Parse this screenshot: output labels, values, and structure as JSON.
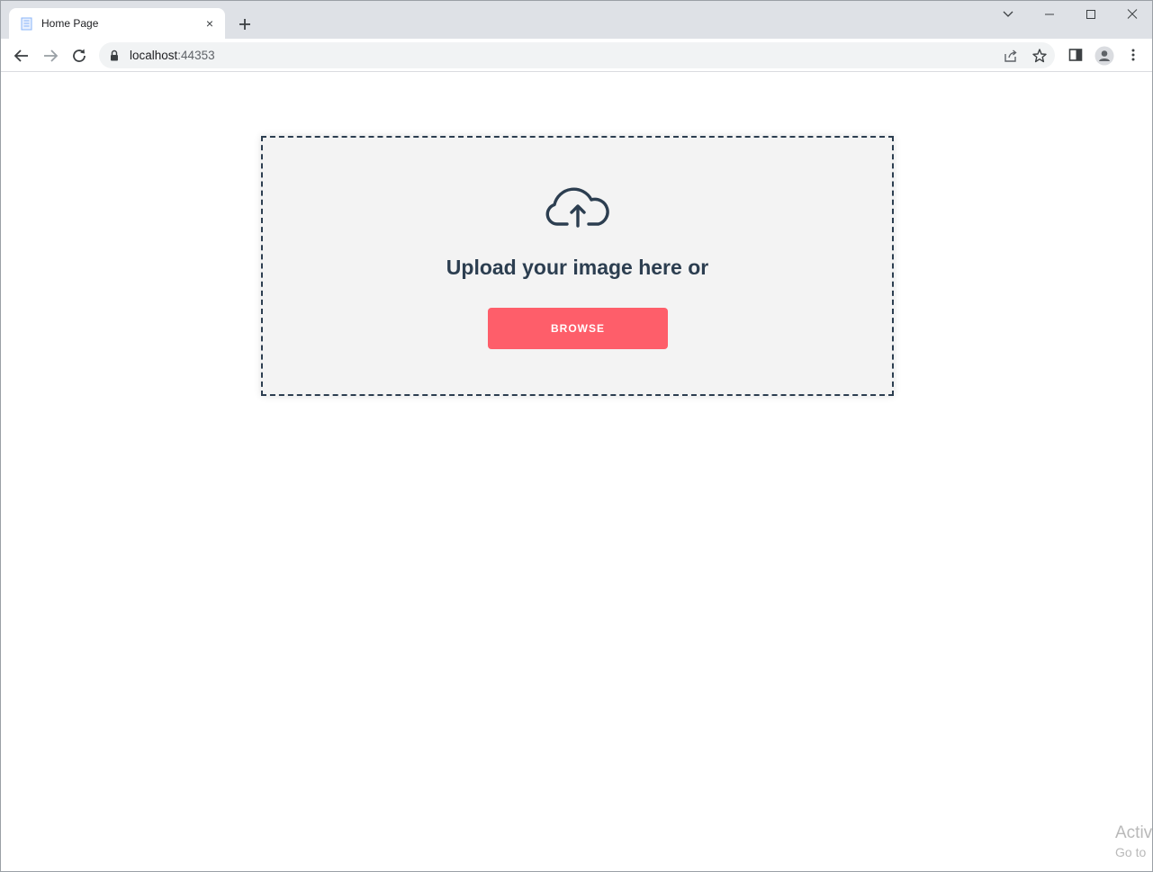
{
  "browser": {
    "tab": {
      "title": "Home Page",
      "close_glyph": "×",
      "favicon": "page-icon"
    },
    "new_tab_icon": "plus-icon",
    "window_controls": [
      "tab-search-icon",
      "minimize-icon",
      "maximize-icon",
      "close-icon"
    ],
    "address": {
      "host": "localhost",
      "port": ":44353"
    },
    "toolbar_icons": [
      "back-icon",
      "forward-icon",
      "reload-icon",
      "lock-icon",
      "share-icon",
      "star-icon",
      "side-panel-icon",
      "profile-icon",
      "menu-icon"
    ]
  },
  "page": {
    "upload_icon": "cloud-upload-icon",
    "upload_text": "Upload your image here or",
    "browse_label": "BROWSE"
  },
  "watermark": {
    "line1": "Activ",
    "line2": "Go to"
  },
  "colors": {
    "accent": "#fe5e6a",
    "text_dark": "#2c3e50",
    "dropzone_bg": "#f3f3f3"
  }
}
